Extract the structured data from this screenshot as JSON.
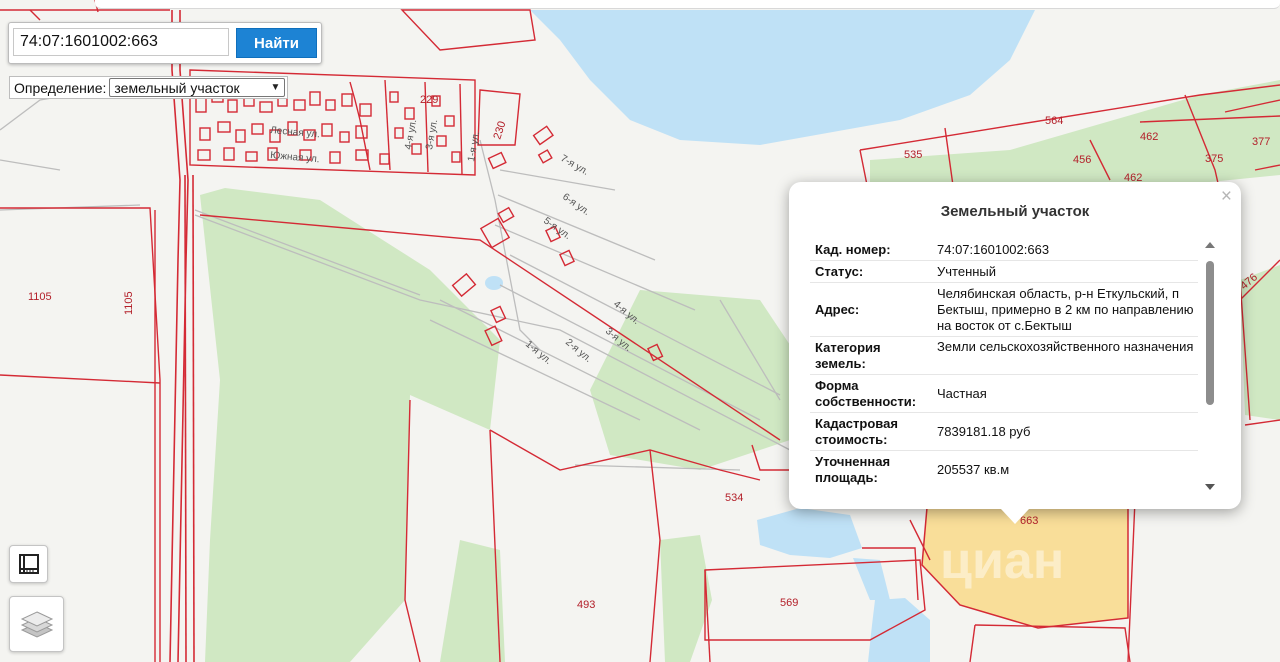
{
  "search": {
    "value": "74:07:1601002:663",
    "button_label": "Найти"
  },
  "definition": {
    "label": "Определение:",
    "selected": "земельный участок"
  },
  "map": {
    "parcel_numbers": [
      "1105",
      "1105",
      "229",
      "230",
      "564",
      "462",
      "377",
      "535",
      "456",
      "375",
      "462",
      "476",
      "534",
      "493",
      "569",
      "663"
    ],
    "streets": [
      "7-я ул.",
      "6-я ул.",
      "5-я ул.",
      "4-я ул.",
      "3-я ул.",
      "2-я ул.",
      "1-я ул.",
      "1-я ул.",
      "3-я ул.",
      "4-я ул.",
      "Южная ул.",
      "Лесная ул."
    ],
    "watermark": "циан"
  },
  "popup": {
    "title": "Земельный участок",
    "close": "×",
    "rows": [
      {
        "label": "Кад. номер",
        "value": "74:07:1601002:663"
      },
      {
        "label": "Статус",
        "value": "Учтенный"
      },
      {
        "label": "Адрес",
        "value": "Челябинская область, р-н Еткульский, п Бектыш, примерно в 2 км по направлению на восток от с.Бектыш"
      },
      {
        "label": "Категория земель",
        "value": "Земли сельскохозяйственного назначения"
      },
      {
        "label": "Форма собственности",
        "value": "Частная"
      },
      {
        "label": "Кадастровая стоимость",
        "value": "7839181.18 руб"
      },
      {
        "label": "Уточненная площадь",
        "value": "205537 кв.м"
      }
    ]
  },
  "colors": {
    "parcel_border": "#d42a35",
    "water": "#bfe1f6",
    "forest": "#cfe7c2",
    "highlight": "#f9d98a",
    "button": "#1d83d4"
  }
}
